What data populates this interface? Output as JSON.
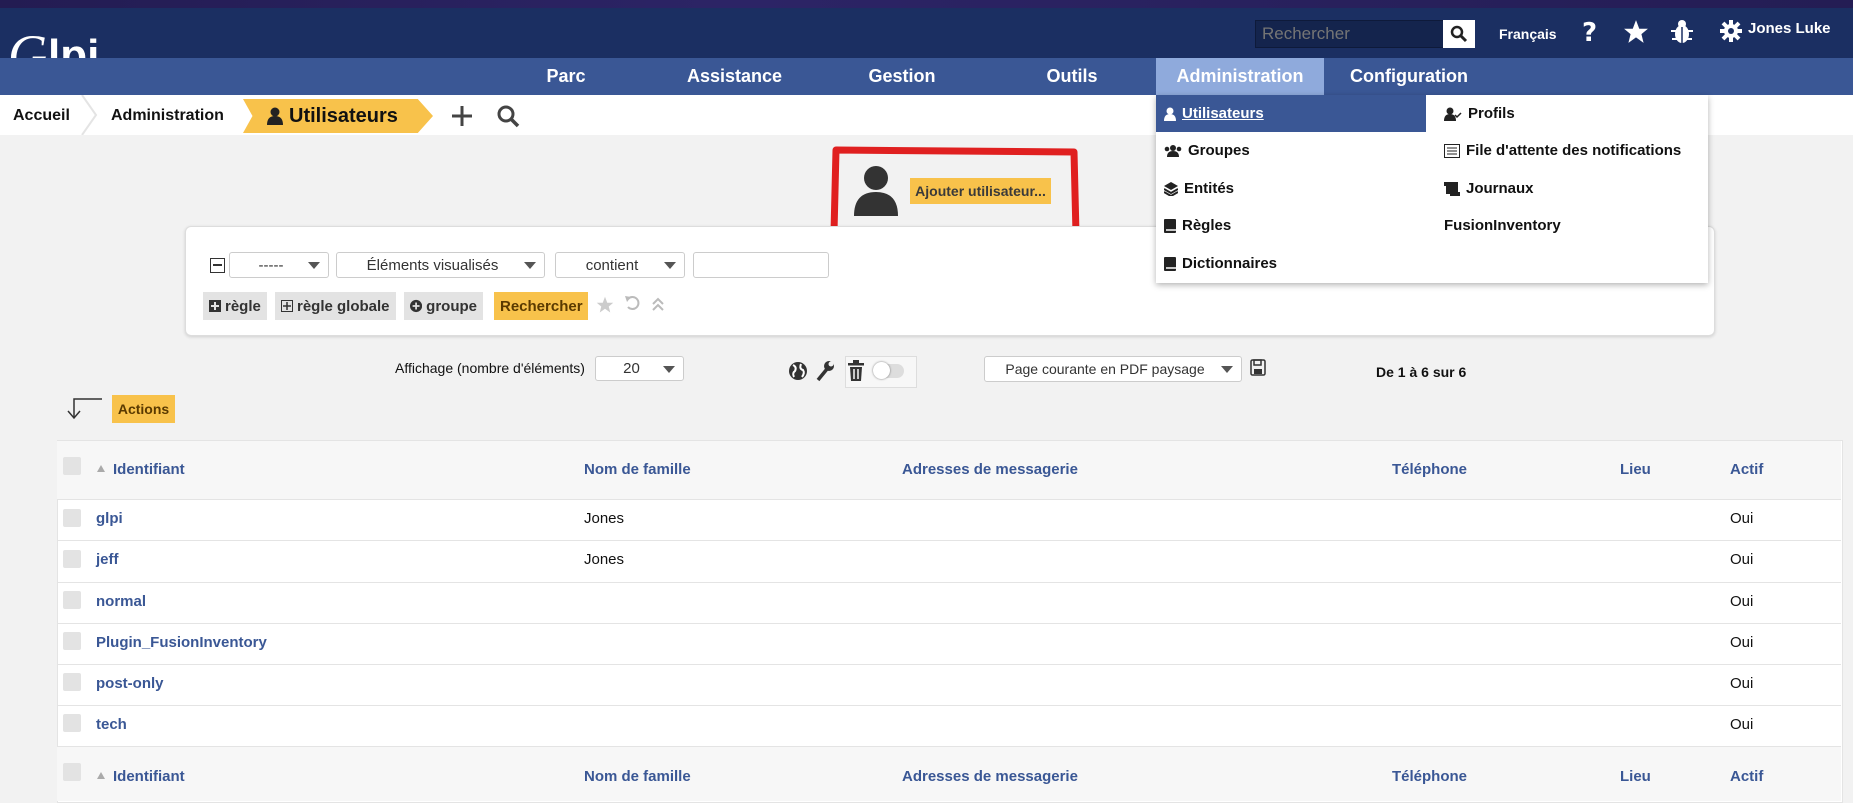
{
  "header": {
    "logo_text": "Glpi",
    "search_placeholder": "Rechercher",
    "language": "Français",
    "user_name": "Jones Luke",
    "icons": [
      "help-icon",
      "star-icon",
      "bug-icon",
      "gear-icon"
    ]
  },
  "nav": {
    "items": [
      {
        "label": "Parc"
      },
      {
        "label": "Assistance"
      },
      {
        "label": "Gestion"
      },
      {
        "label": "Outils"
      },
      {
        "label": "Administration"
      },
      {
        "label": "Configuration"
      }
    ]
  },
  "breadcrumb": {
    "items": [
      {
        "label": "Accueil"
      },
      {
        "label": "Administration"
      }
    ],
    "active": "Utilisateurs"
  },
  "add_user": {
    "label": "Ajouter utilisateur..."
  },
  "search_panel": {
    "field_select": "-----",
    "criteria_select": "Éléments visualisés",
    "operator_select": "contient",
    "value": "",
    "buttons": {
      "rule": "règle",
      "global_rule": "règle globale",
      "group": "groupe",
      "search": "Rechercher"
    }
  },
  "pager": {
    "display_label": "Affichage (nombre d'éléments)",
    "display_value": "20",
    "export_select": "Page courante en PDF paysage",
    "count_text": "De 1 à 6 sur 6",
    "actions_label": "Actions"
  },
  "table": {
    "headers": [
      "Identifiant",
      "Nom de famille",
      "Adresses de messagerie",
      "Téléphone",
      "Lieu",
      "Actif"
    ],
    "rows": [
      {
        "id": "glpi",
        "last_name": "Jones",
        "email": "",
        "phone": "",
        "location": "",
        "active": "Oui"
      },
      {
        "id": "jeff",
        "last_name": "Jones",
        "email": "",
        "phone": "",
        "location": "",
        "active": "Oui"
      },
      {
        "id": "normal",
        "last_name": "",
        "email": "",
        "phone": "",
        "location": "",
        "active": "Oui"
      },
      {
        "id": "Plugin_FusionInventory",
        "last_name": "",
        "email": "",
        "phone": "",
        "location": "",
        "active": "Oui"
      },
      {
        "id": "post-only",
        "last_name": "",
        "email": "",
        "phone": "",
        "location": "",
        "active": "Oui"
      },
      {
        "id": "tech",
        "last_name": "",
        "email": "",
        "phone": "",
        "location": "",
        "active": "Oui"
      }
    ]
  },
  "dropdown": {
    "left": [
      "Utilisateurs",
      "Groupes",
      "Entités",
      "Règles",
      "Dictionnaires"
    ],
    "right": [
      "Profils",
      "File d'attente des notifications",
      "Journaux",
      "FusionInventory"
    ]
  },
  "colors": {
    "accent": "#f8c24b",
    "nav": "#3a5795",
    "header": "#1b2f62",
    "highlight": "#e02020"
  }
}
